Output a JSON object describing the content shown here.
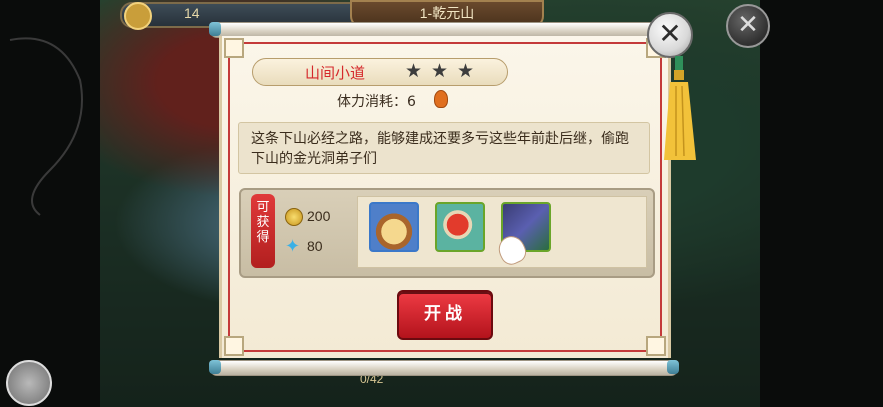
{
  "hud": {
    "player_count": "14",
    "stage_title": "1-乾元山",
    "progress_text": "0/42"
  },
  "dialog": {
    "stage_name": "山间小道",
    "stars": 3,
    "cost_label": "体力消耗：6",
    "description": "这条下山必经之路，能够建成还要多亏这些年前赴后继，偷跑下山的金光洞弟子们",
    "rewards": {
      "tag": "可获得",
      "coin": "200",
      "gem": "80",
      "items": [
        "steamed-bun-icon",
        "drum-icon",
        "banner-flag-icon"
      ]
    },
    "battle_button": "开战"
  },
  "colors": {
    "title_red": "#d5282b",
    "button_red": "#d8232d"
  }
}
